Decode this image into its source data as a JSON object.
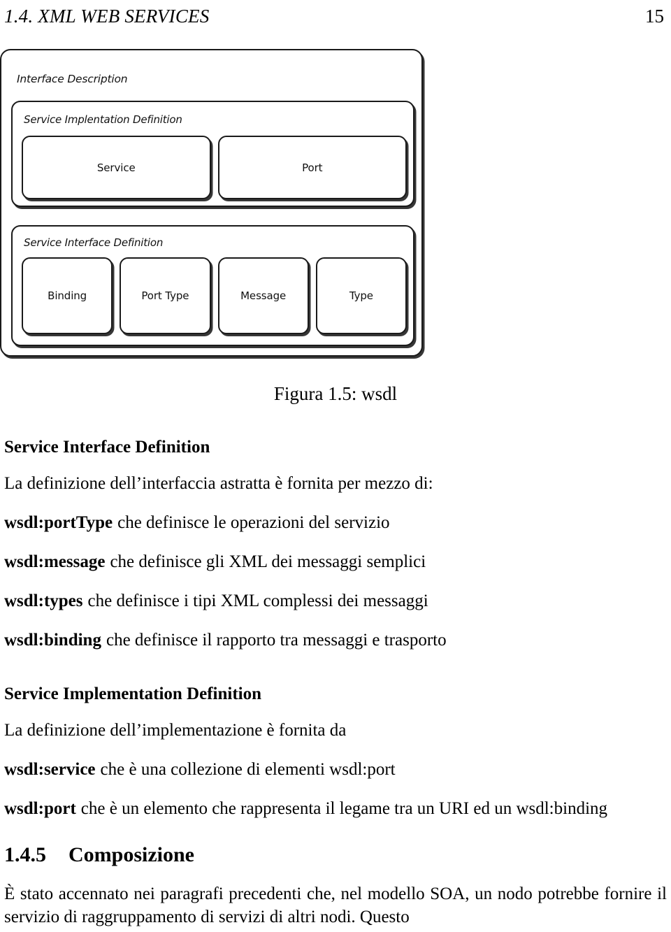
{
  "running_head": {
    "section_title": "1.4.  XML WEB SERVICES",
    "page_number": "15"
  },
  "figure": {
    "caption": "Figura 1.5: wsdl",
    "outer_label": "Interface Description",
    "bands": [
      {
        "label": "Service Implentation Definition",
        "leaves": [
          "Service",
          "Port"
        ]
      },
      {
        "label": "Service Interface Definition",
        "leaves": [
          "Binding",
          "Port Type",
          "Message",
          "Type"
        ]
      }
    ]
  },
  "sections": [
    {
      "heading": "Service Interface Definition",
      "intro": "La definizione dell’interfaccia astratta è fornita per mezzo di:",
      "items": [
        {
          "term": "wsdl:portType",
          "desc": "che definisce le operazioni del servizio"
        },
        {
          "term": "wsdl:message",
          "desc": "che definisce gli XML dei messaggi semplici"
        },
        {
          "term": "wsdl:types",
          "desc": "che definisce i tipi XML complessi dei messaggi"
        },
        {
          "term": "wsdl:binding",
          "desc": "che definisce il rapporto tra messaggi e trasporto"
        }
      ]
    },
    {
      "heading": "Service Implementation Definition",
      "intro": "La definizione dell’implementazione è fornita da",
      "items": [
        {
          "term": "wsdl:service",
          "desc": "che è una collezione di elementi wsdl:port"
        },
        {
          "term": "wsdl:port",
          "desc": "che è un elemento che rappresenta il legame tra un URI ed un wsdl:binding"
        }
      ]
    }
  ],
  "numbered_section": {
    "number": "1.4.5",
    "title": "Composizione",
    "body": "È stato accennato nei paragrafi precedenti che, nel modello SOA, un nodo potrebbe fornire il servizio di raggruppamento di servizi di altri nodi. Questo"
  }
}
